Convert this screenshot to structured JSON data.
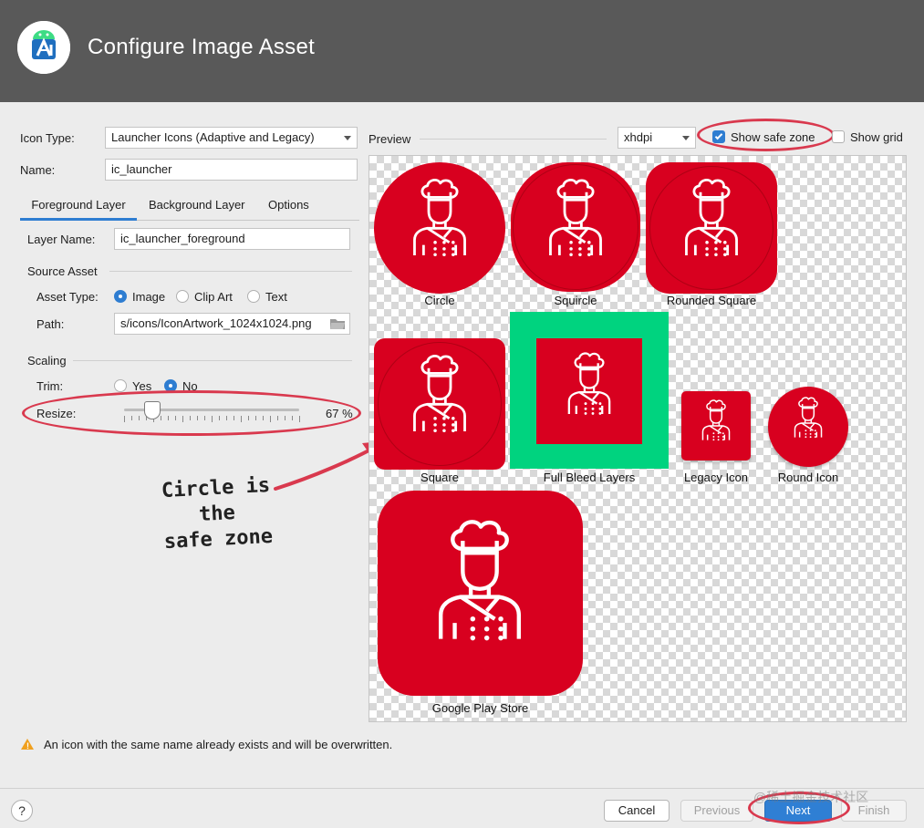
{
  "window": {
    "title": "Configure Image Asset",
    "app_icon": "android-studio-icon"
  },
  "form": {
    "icon_type_label": "Icon Type:",
    "icon_type_value": "Launcher Icons (Adaptive and Legacy)",
    "name_label": "Name:",
    "name_value": "ic_launcher",
    "tabs": [
      {
        "label": "Foreground Layer",
        "active": true
      },
      {
        "label": "Background Layer",
        "active": false
      },
      {
        "label": "Options",
        "active": false
      }
    ],
    "layer_name_label": "Layer Name:",
    "layer_name_value": "ic_launcher_foreground",
    "source_asset_heading": "Source Asset",
    "asset_type_label": "Asset Type:",
    "asset_type_options": [
      "Image",
      "Clip Art",
      "Text"
    ],
    "asset_type_selected": "Image",
    "path_label": "Path:",
    "path_value": "s/icons/IconArtwork_1024x1024.png",
    "path_icon": "folder-icon",
    "scaling_heading": "Scaling",
    "trim_label": "Trim:",
    "trim_options": [
      "Yes",
      "No"
    ],
    "trim_selected": "No",
    "resize_label": "Resize:",
    "resize_value": 67,
    "resize_display": "67 %"
  },
  "annotation": {
    "line1": "Circle is the",
    "line2": "safe zone",
    "color": "#d9394e"
  },
  "preview": {
    "label": "Preview",
    "density": "xhdpi",
    "show_safe_zone_label": "Show safe zone",
    "show_safe_zone": true,
    "show_grid_label": "Show grid",
    "show_grid": false,
    "icon_color": "#d8001f",
    "bleed_color": "#00d37f",
    "icons": {
      "circle": "Circle",
      "squircle": "Squircle",
      "rounded_square": "Rounded Square",
      "square": "Square",
      "full_bleed": "Full Bleed Layers",
      "legacy": "Legacy Icon",
      "round": "Round Icon",
      "play_store": "Google Play Store"
    }
  },
  "warning": {
    "icon": "warning-icon",
    "text": "An icon with the same name already exists and will be overwritten."
  },
  "footer": {
    "help": "?",
    "cancel": "Cancel",
    "previous": "Previous",
    "next": "Next",
    "finish": "Finish",
    "watermark": "@稀土掘金技术社区"
  }
}
